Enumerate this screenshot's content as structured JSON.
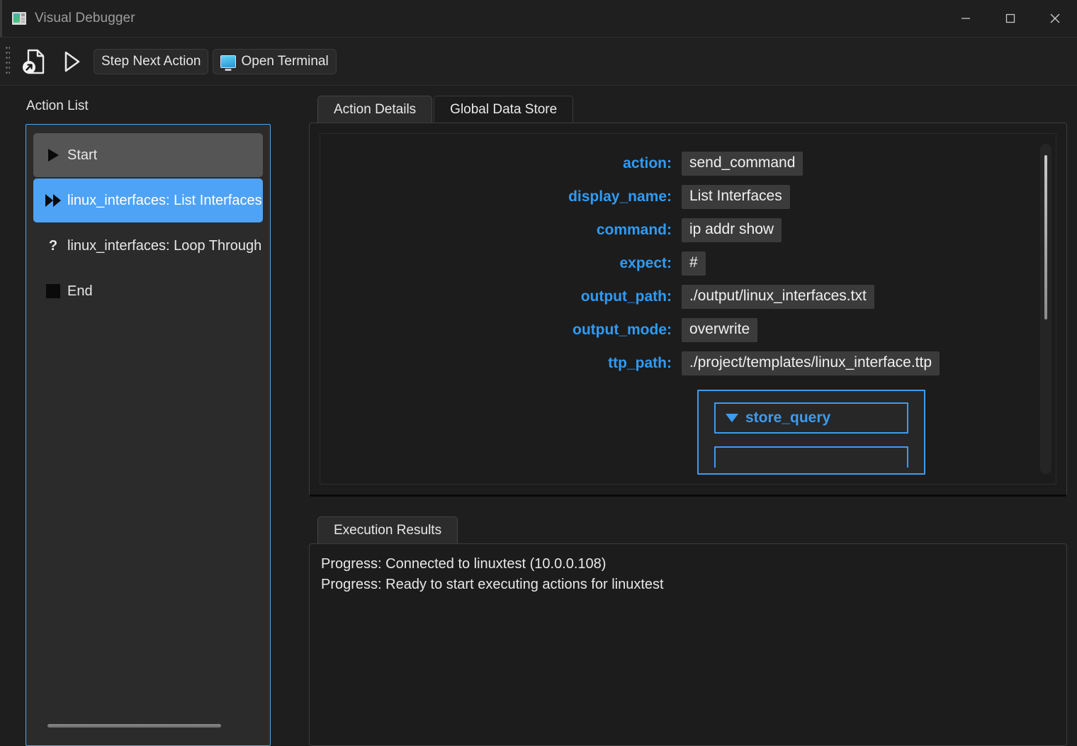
{
  "window": {
    "title": "Visual Debugger",
    "app_icon": "window-chart-icon",
    "controls": {
      "minimize": "minimize-icon",
      "maximize": "maximize-icon",
      "close": "close-icon"
    }
  },
  "toolbar": {
    "grip": "drag-grip",
    "load_file_icon": "file-open-icon",
    "run_icon": "play-icon",
    "step_label": "Step Next Action",
    "terminal_label": "Open Terminal",
    "terminal_icon": "monitor-icon"
  },
  "action_list": {
    "caption": "Action List",
    "items": [
      {
        "label": "Start",
        "glyph": "play-triangle-icon",
        "state": "done"
      },
      {
        "label": "linux_interfaces: List Interfaces",
        "glyph": "fast-forward-icon",
        "state": "current"
      },
      {
        "label": "linux_interfaces: Loop Through Int",
        "glyph": "question-mark-icon",
        "state": "pending"
      },
      {
        "label": "End",
        "glyph": "stop-square-icon",
        "state": "end"
      }
    ]
  },
  "details": {
    "tabs": [
      {
        "label": "Action Details",
        "active": true
      },
      {
        "label": "Global Data Store",
        "active": false
      }
    ],
    "fields": [
      {
        "label": "action:",
        "value": "send_command"
      },
      {
        "label": "display_name:",
        "value": "List Interfaces"
      },
      {
        "label": "command:",
        "value": "ip addr show"
      },
      {
        "label": "expect:",
        "value": "#"
      },
      {
        "label": "output_path:",
        "value": "./output/linux_interfaces.txt"
      },
      {
        "label": "output_mode:",
        "value": "overwrite"
      },
      {
        "label": "ttp_path:",
        "value": "./project/templates/linux_interface.ttp"
      }
    ],
    "store_query": {
      "label": "store_query",
      "caret": "caret-down-icon",
      "expanded": true
    }
  },
  "results": {
    "tab_label": "Execution Results",
    "lines": [
      "Progress: Connected to linuxtest (10.0.0.108)",
      "Progress: Ready to start executing actions for linuxtest"
    ]
  },
  "colors": {
    "accent_blue": "#4ea3f7",
    "label_blue": "#2f9bf5",
    "panel_bg": "#1c1c1c",
    "window_bg": "#1e1e1e",
    "value_bg": "#3b3b3b",
    "selected_bg": "#4ea3f7",
    "done_bg": "#555555"
  }
}
